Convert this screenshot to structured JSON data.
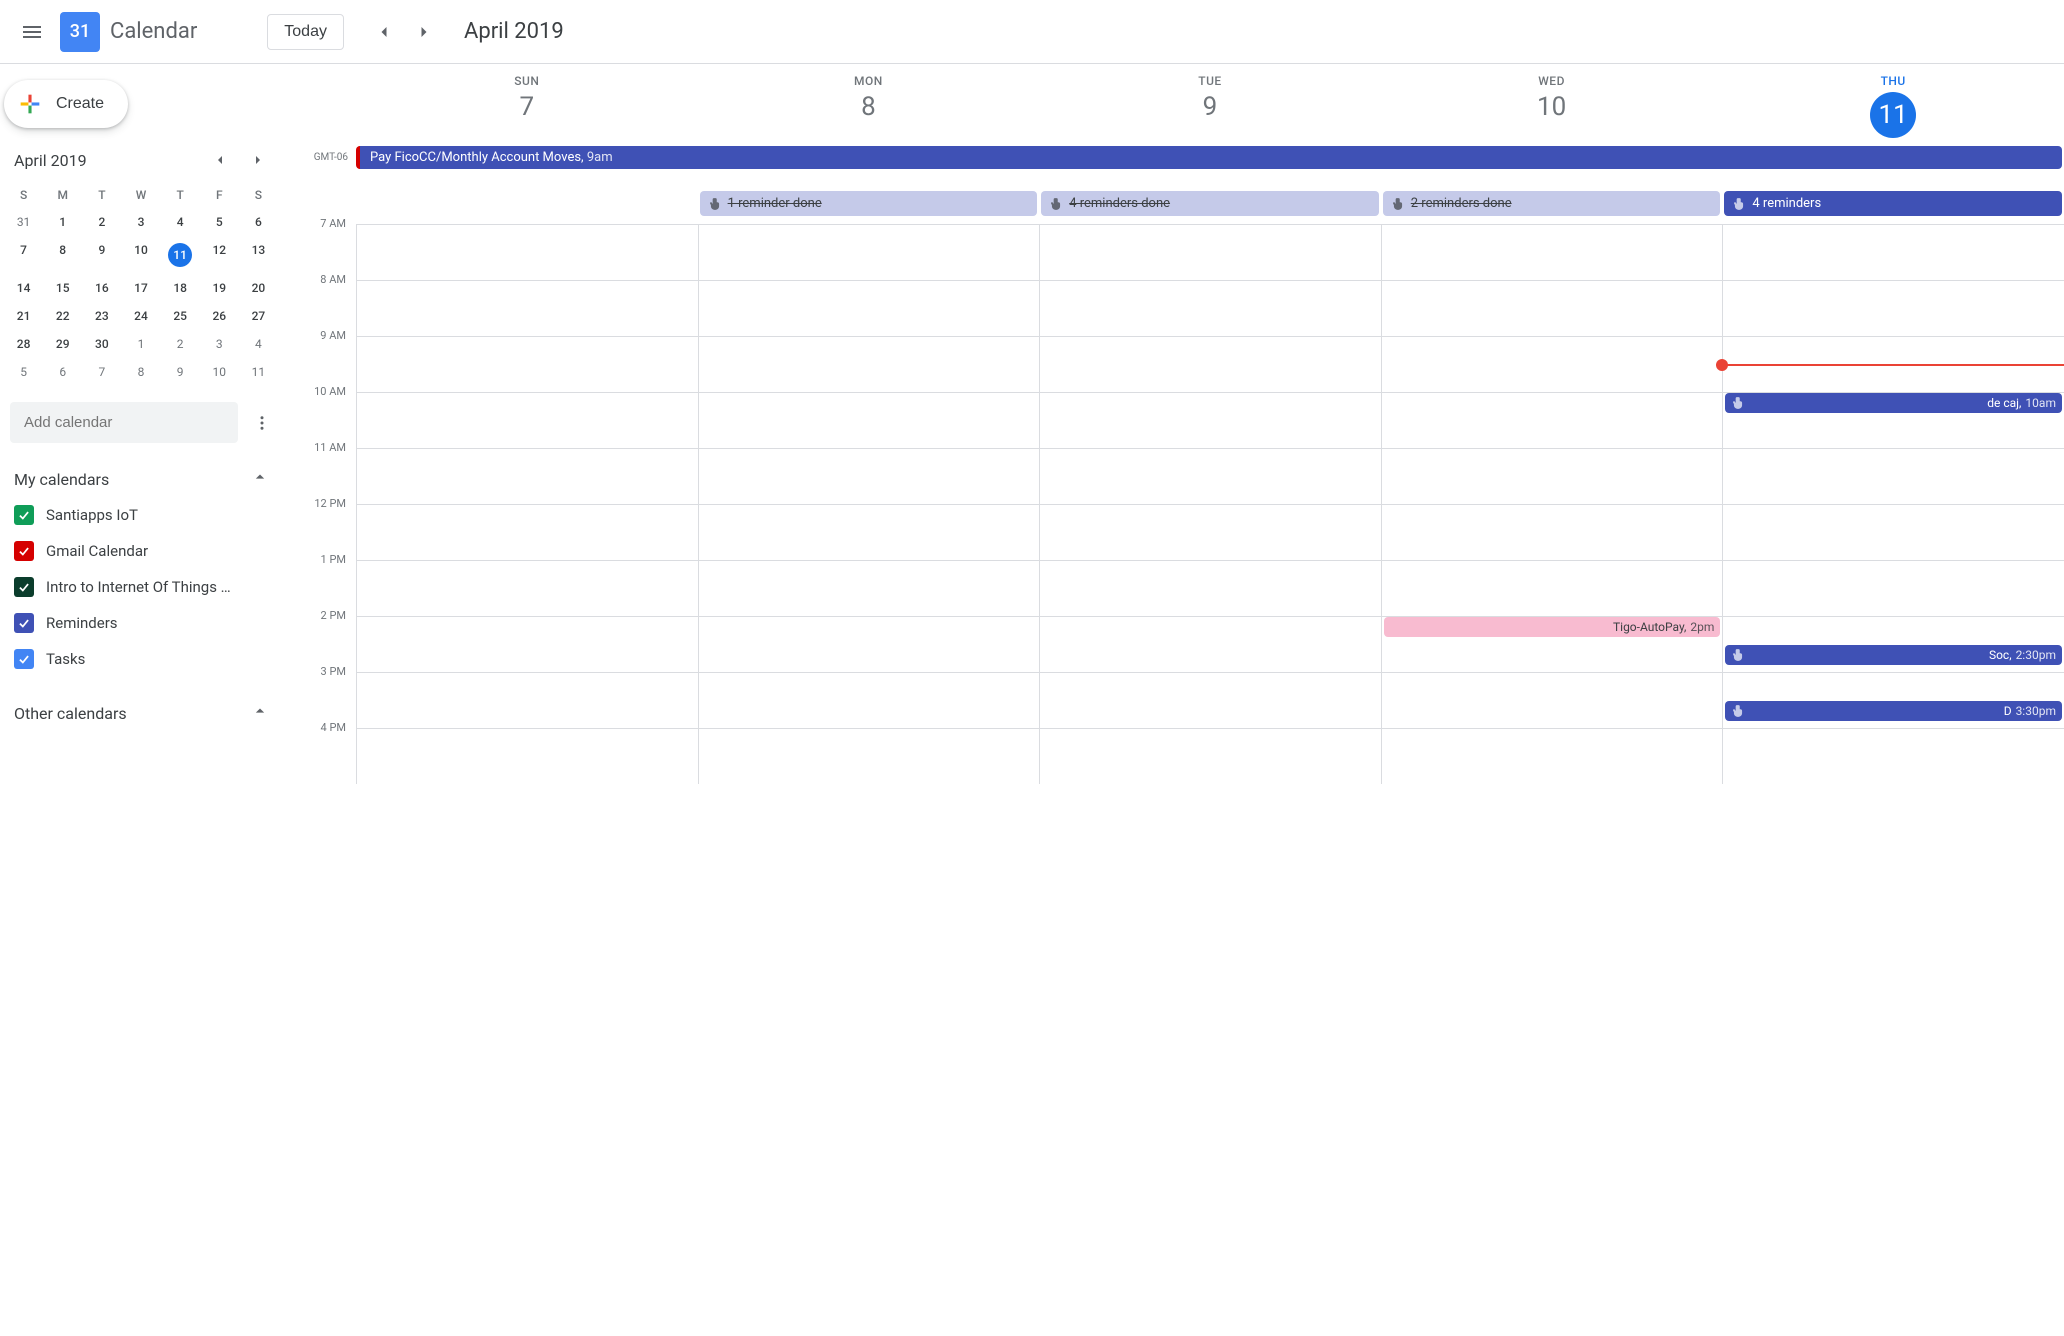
{
  "header": {
    "logo_day": "31",
    "app_name": "Calendar",
    "today_label": "Today",
    "month_label": "April 2019"
  },
  "sidebar": {
    "create_label": "Create",
    "mini_title": "April 2019",
    "dow": [
      "S",
      "M",
      "T",
      "W",
      "T",
      "F",
      "S"
    ],
    "weeks": [
      [
        {
          "d": "31",
          "m": true
        },
        {
          "d": "1"
        },
        {
          "d": "2"
        },
        {
          "d": "3"
        },
        {
          "d": "4"
        },
        {
          "d": "5"
        },
        {
          "d": "6"
        }
      ],
      [
        {
          "d": "7"
        },
        {
          "d": "8"
        },
        {
          "d": "9"
        },
        {
          "d": "10"
        },
        {
          "d": "11",
          "sel": true
        },
        {
          "d": "12"
        },
        {
          "d": "13"
        }
      ],
      [
        {
          "d": "14"
        },
        {
          "d": "15"
        },
        {
          "d": "16"
        },
        {
          "d": "17"
        },
        {
          "d": "18"
        },
        {
          "d": "19"
        },
        {
          "d": "20"
        }
      ],
      [
        {
          "d": "21"
        },
        {
          "d": "22"
        },
        {
          "d": "23"
        },
        {
          "d": "24"
        },
        {
          "d": "25"
        },
        {
          "d": "26"
        },
        {
          "d": "27"
        }
      ],
      [
        {
          "d": "28"
        },
        {
          "d": "29"
        },
        {
          "d": "30"
        },
        {
          "d": "1",
          "m": true
        },
        {
          "d": "2",
          "m": true
        },
        {
          "d": "3",
          "m": true
        },
        {
          "d": "4",
          "m": true
        }
      ],
      [
        {
          "d": "5",
          "m": true
        },
        {
          "d": "6",
          "m": true
        },
        {
          "d": "7",
          "m": true
        },
        {
          "d": "8",
          "m": true
        },
        {
          "d": "9",
          "m": true
        },
        {
          "d": "10",
          "m": true
        },
        {
          "d": "11",
          "m": true
        }
      ]
    ],
    "add_placeholder": "Add calendar",
    "my_calendars_label": "My calendars",
    "other_calendars_label": "Other calendars",
    "calendars": [
      {
        "label": "Santiapps IoT",
        "color": "#0f9d58"
      },
      {
        "label": "Gmail Calendar",
        "color": "#d50000"
      },
      {
        "label": "Intro to Internet Of Things …",
        "color": "#0b3d2c"
      },
      {
        "label": "Reminders",
        "color": "#3f51b5"
      },
      {
        "label": "Tasks",
        "color": "#4285f4"
      }
    ]
  },
  "week": {
    "tz": "GMT-06",
    "days": [
      {
        "dow": "SUN",
        "num": "7"
      },
      {
        "dow": "MON",
        "num": "8"
      },
      {
        "dow": "TUE",
        "num": "9"
      },
      {
        "dow": "WED",
        "num": "10"
      },
      {
        "dow": "THU",
        "num": "11",
        "today": true
      }
    ],
    "allday": {
      "title": "Pay FicoCC/Monthly Account Moves,",
      "time": "9am"
    },
    "reminders": [
      {
        "text": "",
        "done": false,
        "empty": true
      },
      {
        "text": "1 reminder done",
        "done": true
      },
      {
        "text": "4 reminders done",
        "done": true
      },
      {
        "text": "2 reminders done",
        "done": true
      },
      {
        "text": "4 reminders",
        "done": false,
        "active": true
      }
    ],
    "hours": [
      "7 AM",
      "8 AM",
      "9 AM",
      "10 AM",
      "11 AM",
      "12 PM",
      "1 PM",
      "2 PM",
      "3 PM",
      "4 PM"
    ],
    "events": [
      {
        "day": 4,
        "hour_idx": 3,
        "offset": 0,
        "label": "de caj,",
        "time": "10am",
        "color": "blue"
      },
      {
        "day": 3,
        "hour_idx": 7,
        "offset": 0,
        "label": "Tigo-AutoPay,",
        "time": "2pm",
        "color": "pink"
      },
      {
        "day": 4,
        "hour_idx": 7,
        "offset": 28,
        "label": "Soc,",
        "time": "2:30pm",
        "color": "blue"
      },
      {
        "day": 4,
        "hour_idx": 8,
        "offset": 28,
        "label": "D",
        "time": "3:30pm",
        "color": "blue"
      }
    ],
    "now": {
      "day": 4,
      "hour_idx": 2,
      "offset": 28
    }
  }
}
